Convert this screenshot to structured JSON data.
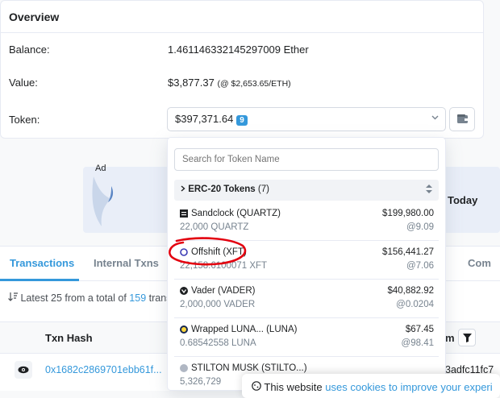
{
  "overview": {
    "title": "Overview",
    "balance_label": "Balance:",
    "balance_value": "1.461146332145297009 Ether",
    "value_label": "Value:",
    "value_amount": "$3,877.37",
    "value_rate": "(@ $2,653.65/ETH)",
    "token_label": "Token:",
    "token_total": "$397,371.64",
    "token_count": "9"
  },
  "dropdown": {
    "search_placeholder": "Search for Token Name",
    "section_title": "ERC-20 Tokens",
    "section_count": "(7)",
    "tokens": [
      {
        "name": "Sandclock (QUARTZ)",
        "qty": "22,000 QUARTZ",
        "value": "$199,980.00",
        "price": "@9.09",
        "icon": "sandclock-icon"
      },
      {
        "name": "Offshift (XFT)",
        "qty": "22,158.6100071 XFT",
        "value": "$156,441.27",
        "price": "@7.06",
        "icon": "offshift-icon"
      },
      {
        "name": "Vader (VADER)",
        "qty": "2,000,000 VADER",
        "value": "$40,882.92",
        "price": "@0.0204",
        "icon": "vader-icon"
      },
      {
        "name": "Wrapped LUNA... (LUNA)",
        "qty": "0.68542558 LUNA",
        "value": "$67.45",
        "price": "@98.41",
        "icon": "luna-icon"
      },
      {
        "name": "STILTON MUSK (STILTO...)",
        "qty": "5,326,729",
        "value": "",
        "price": "",
        "icon": "stilton-icon"
      }
    ]
  },
  "ad": {
    "label": "Ad",
    "text": "rt Today"
  },
  "tabs": {
    "transactions": "Transactions",
    "internal": "Internal Txns",
    "comments": "Com"
  },
  "list": {
    "latest_prefix": "Latest 25 from a total of",
    "total": "159",
    "latest_suffix": "trans"
  },
  "table": {
    "col_txhash": "Txn Hash",
    "col_to": "m",
    "row_hash": "0x1682c2869701ebb61f...",
    "row_addr": "3adfc11fc7"
  },
  "cookie": {
    "prefix": "This website",
    "link": "uses cookies to improve your experi"
  },
  "colors": {
    "accent": "#3498db",
    "annotation": "#e3000f"
  }
}
